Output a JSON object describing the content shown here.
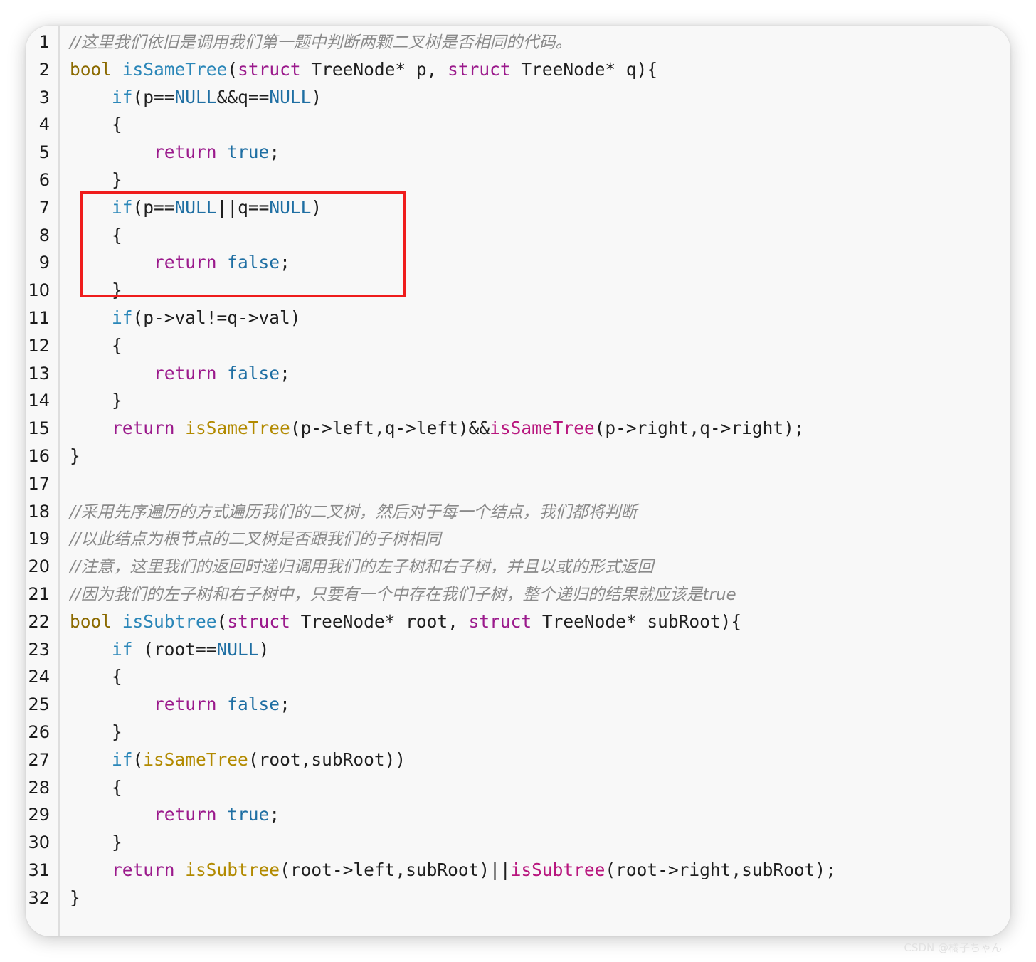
{
  "code": {
    "lines": [
      {
        "n": "1",
        "tokens": [
          {
            "t": "//这里我们依旧是调用我们第一题中判断两颗二叉树是否相同的代码。",
            "c": "comment"
          }
        ]
      },
      {
        "n": "2",
        "tokens": [
          {
            "t": "bool",
            "c": "type"
          },
          {
            "t": " ",
            "c": "plain"
          },
          {
            "t": "isSameTree",
            "c": "func"
          },
          {
            "t": "(",
            "c": "plain"
          },
          {
            "t": "struct",
            "c": "keyword"
          },
          {
            "t": " TreeNode* p, ",
            "c": "plain"
          },
          {
            "t": "struct",
            "c": "keyword"
          },
          {
            "t": " TreeNode* q){",
            "c": "plain"
          }
        ]
      },
      {
        "n": "3",
        "tokens": [
          {
            "t": "    ",
            "c": "plain"
          },
          {
            "t": "if",
            "c": "func"
          },
          {
            "t": "(p==",
            "c": "plain"
          },
          {
            "t": "NULL",
            "c": "literal"
          },
          {
            "t": "&&q==",
            "c": "plain"
          },
          {
            "t": "NULL",
            "c": "literal"
          },
          {
            "t": ")",
            "c": "plain"
          }
        ]
      },
      {
        "n": "4",
        "tokens": [
          {
            "t": "    {",
            "c": "plain"
          }
        ]
      },
      {
        "n": "5",
        "tokens": [
          {
            "t": "        ",
            "c": "plain"
          },
          {
            "t": "return",
            "c": "flow"
          },
          {
            "t": " ",
            "c": "plain"
          },
          {
            "t": "true",
            "c": "literal"
          },
          {
            "t": ";",
            "c": "plain"
          }
        ]
      },
      {
        "n": "6",
        "tokens": [
          {
            "t": "    }",
            "c": "plain"
          }
        ]
      },
      {
        "n": "7",
        "tokens": [
          {
            "t": "    ",
            "c": "plain"
          },
          {
            "t": "if",
            "c": "func"
          },
          {
            "t": "(p==",
            "c": "plain"
          },
          {
            "t": "NULL",
            "c": "literal"
          },
          {
            "t": "||q==",
            "c": "plain"
          },
          {
            "t": "NULL",
            "c": "literal"
          },
          {
            "t": ")",
            "c": "plain"
          }
        ]
      },
      {
        "n": "8",
        "tokens": [
          {
            "t": "    {",
            "c": "plain"
          }
        ]
      },
      {
        "n": "9",
        "tokens": [
          {
            "t": "        ",
            "c": "plain"
          },
          {
            "t": "return",
            "c": "flow"
          },
          {
            "t": " ",
            "c": "plain"
          },
          {
            "t": "false",
            "c": "literal"
          },
          {
            "t": ";",
            "c": "plain"
          }
        ]
      },
      {
        "n": "10",
        "tokens": [
          {
            "t": "    }",
            "c": "plain"
          }
        ]
      },
      {
        "n": "11",
        "tokens": [
          {
            "t": "    ",
            "c": "plain"
          },
          {
            "t": "if",
            "c": "func"
          },
          {
            "t": "(p->val!=q->val)",
            "c": "plain"
          }
        ]
      },
      {
        "n": "12",
        "tokens": [
          {
            "t": "    {",
            "c": "plain"
          }
        ]
      },
      {
        "n": "13",
        "tokens": [
          {
            "t": "        ",
            "c": "plain"
          },
          {
            "t": "return",
            "c": "flow"
          },
          {
            "t": " ",
            "c": "plain"
          },
          {
            "t": "false",
            "c": "literal"
          },
          {
            "t": ";",
            "c": "plain"
          }
        ]
      },
      {
        "n": "14",
        "tokens": [
          {
            "t": "    }",
            "c": "plain"
          }
        ]
      },
      {
        "n": "15",
        "tokens": [
          {
            "t": "    ",
            "c": "plain"
          },
          {
            "t": "return",
            "c": "flow"
          },
          {
            "t": " ",
            "c": "plain"
          },
          {
            "t": "isSameTree",
            "c": "call"
          },
          {
            "t": "(p->left,q->left)&&",
            "c": "plain"
          },
          {
            "t": "isSameTree",
            "c": "call2"
          },
          {
            "t": "(p->right,q->right);",
            "c": "plain"
          }
        ]
      },
      {
        "n": "16",
        "tokens": [
          {
            "t": "}",
            "c": "plain"
          }
        ]
      },
      {
        "n": "17",
        "tokens": []
      },
      {
        "n": "18",
        "tokens": [
          {
            "t": "//采用先序遍历的方式遍历我们的二叉树，然后对于每一个结点，我们都将判断",
            "c": "comment"
          }
        ]
      },
      {
        "n": "19",
        "tokens": [
          {
            "t": "//以此结点为根节点的二叉树是否跟我们的子树相同",
            "c": "comment"
          }
        ]
      },
      {
        "n": "20",
        "tokens": [
          {
            "t": "//注意，这里我们的返回时递归调用我们的左子树和右子树，并且以或的形式返回",
            "c": "comment"
          }
        ]
      },
      {
        "n": "21",
        "tokens": [
          {
            "t": "//因为我们的左子树和右子树中，只要有一个中存在我们子树，整个递归的结果就应该是true",
            "c": "comment"
          }
        ]
      },
      {
        "n": "22",
        "tokens": [
          {
            "t": "bool",
            "c": "type"
          },
          {
            "t": " ",
            "c": "plain"
          },
          {
            "t": "isSubtree",
            "c": "func"
          },
          {
            "t": "(",
            "c": "plain"
          },
          {
            "t": "struct",
            "c": "keyword"
          },
          {
            "t": " TreeNode* root, ",
            "c": "plain"
          },
          {
            "t": "struct",
            "c": "keyword"
          },
          {
            "t": " TreeNode* subRoot){",
            "c": "plain"
          }
        ]
      },
      {
        "n": "23",
        "tokens": [
          {
            "t": "    ",
            "c": "plain"
          },
          {
            "t": "if",
            "c": "func"
          },
          {
            "t": " (root==",
            "c": "plain"
          },
          {
            "t": "NULL",
            "c": "literal"
          },
          {
            "t": ")",
            "c": "plain"
          }
        ]
      },
      {
        "n": "24",
        "tokens": [
          {
            "t": "    {",
            "c": "plain"
          }
        ]
      },
      {
        "n": "25",
        "tokens": [
          {
            "t": "        ",
            "c": "plain"
          },
          {
            "t": "return",
            "c": "flow"
          },
          {
            "t": " ",
            "c": "plain"
          },
          {
            "t": "false",
            "c": "literal"
          },
          {
            "t": ";",
            "c": "plain"
          }
        ]
      },
      {
        "n": "26",
        "tokens": [
          {
            "t": "    }",
            "c": "plain"
          }
        ]
      },
      {
        "n": "27",
        "tokens": [
          {
            "t": "    ",
            "c": "plain"
          },
          {
            "t": "if",
            "c": "func"
          },
          {
            "t": "(",
            "c": "plain"
          },
          {
            "t": "isSameTree",
            "c": "call"
          },
          {
            "t": "(root,subRoot))",
            "c": "plain"
          }
        ]
      },
      {
        "n": "28",
        "tokens": [
          {
            "t": "    {",
            "c": "plain"
          }
        ]
      },
      {
        "n": "29",
        "tokens": [
          {
            "t": "        ",
            "c": "plain"
          },
          {
            "t": "return",
            "c": "flow"
          },
          {
            "t": " ",
            "c": "plain"
          },
          {
            "t": "true",
            "c": "literal"
          },
          {
            "t": ";",
            "c": "plain"
          }
        ]
      },
      {
        "n": "30",
        "tokens": [
          {
            "t": "    }",
            "c": "plain"
          }
        ]
      },
      {
        "n": "31",
        "tokens": [
          {
            "t": "    ",
            "c": "plain"
          },
          {
            "t": "return",
            "c": "flow"
          },
          {
            "t": " ",
            "c": "plain"
          },
          {
            "t": "isSubtree",
            "c": "call"
          },
          {
            "t": "(root->left,subRoot)||",
            "c": "plain"
          },
          {
            "t": "isSubtree",
            "c": "call2"
          },
          {
            "t": "(root->right,subRoot);",
            "c": "plain"
          }
        ]
      },
      {
        "n": "32",
        "tokens": [
          {
            "t": "}",
            "c": "plain"
          }
        ]
      }
    ]
  },
  "highlight": {
    "color": "#ef1c1c",
    "first_line": "7",
    "last_line": "10"
  },
  "colors": {
    "comment": "#8a8a8a",
    "type": "#8b6a00",
    "function": "#2a86b8",
    "keyword": "#9b1a8c",
    "literal": "#1f6fa3"
  },
  "watermark": "CSDN @橘子ちゃん"
}
